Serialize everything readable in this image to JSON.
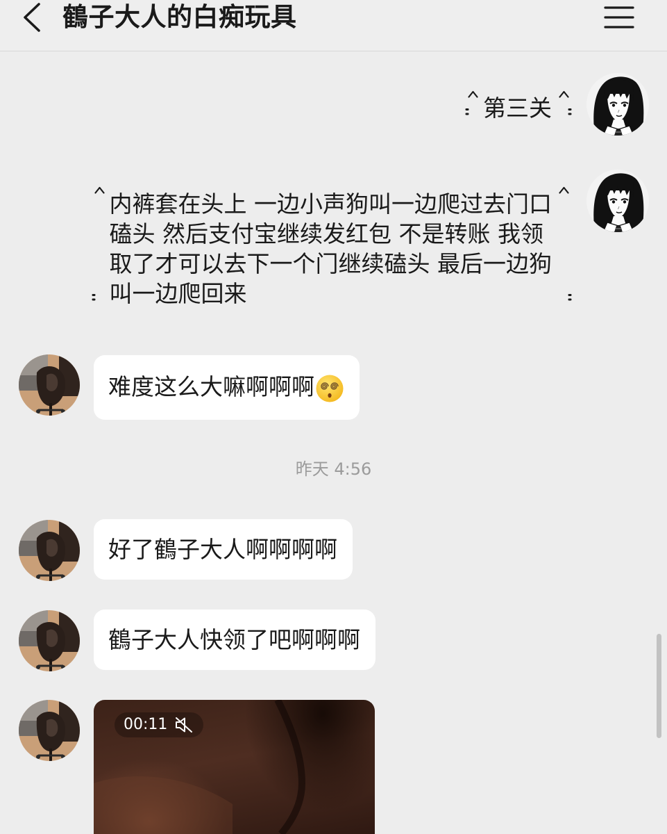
{
  "header": {
    "title": "鶴子大人的白痴玩具",
    "back_icon": "chevron-left-icon",
    "menu_icon": "hamburger-menu-icon"
  },
  "messages": [
    {
      "avatar": "anime-girl-avatar",
      "text": "第三关"
    },
    {
      "avatar": "anime-girl-avatar",
      "lines": [
        "内裤套在头上 一边小声狗叫一边爬过去门口",
        "磕头 然后支付宝继续发红包 不是转账 我领",
        "取了才可以去下一个门继续磕头 最后一边狗",
        "叫一边爬回来"
      ]
    },
    {
      "avatar": "photo-avatar",
      "text": "难度这么大嘛啊啊啊",
      "emoji": "face-with-spiral-eyes-icon"
    },
    {
      "timestamp": "昨天 4:56"
    },
    {
      "avatar": "photo-avatar",
      "text": "好了鶴子大人啊啊啊啊"
    },
    {
      "avatar": "photo-avatar",
      "text": "鶴子大人快领了吧啊啊啊"
    },
    {
      "avatar": "photo-avatar",
      "video": {
        "duration": "00:11",
        "muted": true,
        "mute_icon": "speaker-muted-icon"
      }
    }
  ],
  "theme": {
    "chat_background": "#ededed",
    "header_background": "#eeeeee",
    "bubble_background": "#ffffff",
    "text_color": "#1a1a1a",
    "timestamp_color": "#9b9b9b",
    "scrollbar_color": "#c2c2c2"
  }
}
